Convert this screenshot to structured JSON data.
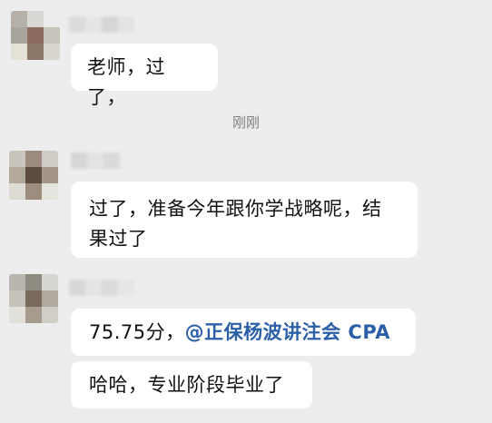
{
  "messages": [
    {
      "text": "老师，过了，"
    },
    {
      "text": "过了，准备今年跟你学战略呢，结果过了"
    },
    {
      "text_before": "75.75分，",
      "mention": "@正保杨波讲注会 CPA"
    },
    {
      "text": "哈哈，专业阶段毕业了"
    }
  ],
  "timestamp": "刚刚",
  "colors": {
    "background": "#ededed",
    "bubble": "#ffffff",
    "mention": "#2b5fa8",
    "timestamp": "#7f7f7f"
  },
  "icons": {
    "avatar_1": "blurred-avatar-icon",
    "avatar_2": "blurred-avatar-icon",
    "avatar_3": "blurred-avatar-icon"
  }
}
